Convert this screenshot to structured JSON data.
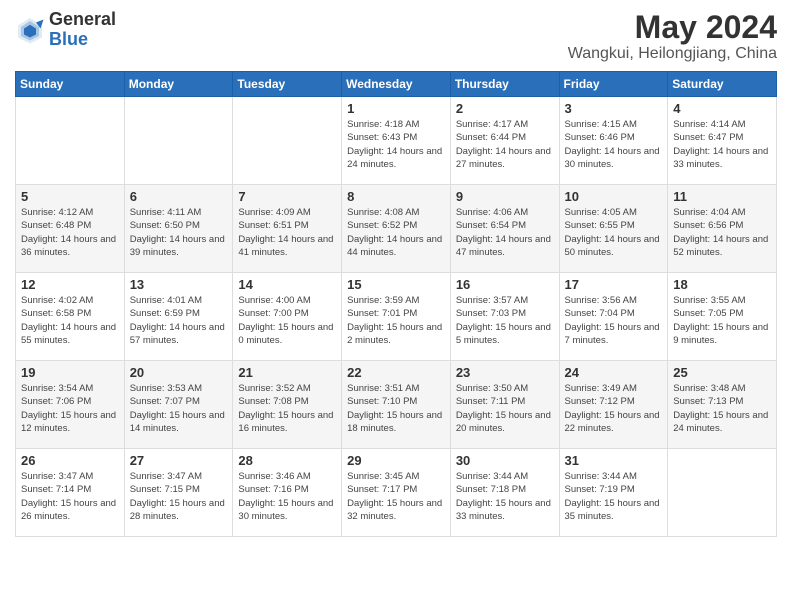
{
  "header": {
    "logo_general": "General",
    "logo_blue": "Blue",
    "month_title": "May 2024",
    "subtitle": "Wangkui, Heilongjiang, China"
  },
  "days_of_week": [
    "Sunday",
    "Monday",
    "Tuesday",
    "Wednesday",
    "Thursday",
    "Friday",
    "Saturday"
  ],
  "weeks": [
    [
      {
        "day": "",
        "info": ""
      },
      {
        "day": "",
        "info": ""
      },
      {
        "day": "",
        "info": ""
      },
      {
        "day": "1",
        "info": "Sunrise: 4:18 AM\nSunset: 6:43 PM\nDaylight: 14 hours\nand 24 minutes."
      },
      {
        "day": "2",
        "info": "Sunrise: 4:17 AM\nSunset: 6:44 PM\nDaylight: 14 hours\nand 27 minutes."
      },
      {
        "day": "3",
        "info": "Sunrise: 4:15 AM\nSunset: 6:46 PM\nDaylight: 14 hours\nand 30 minutes."
      },
      {
        "day": "4",
        "info": "Sunrise: 4:14 AM\nSunset: 6:47 PM\nDaylight: 14 hours\nand 33 minutes."
      }
    ],
    [
      {
        "day": "5",
        "info": "Sunrise: 4:12 AM\nSunset: 6:48 PM\nDaylight: 14 hours\nand 36 minutes."
      },
      {
        "day": "6",
        "info": "Sunrise: 4:11 AM\nSunset: 6:50 PM\nDaylight: 14 hours\nand 39 minutes."
      },
      {
        "day": "7",
        "info": "Sunrise: 4:09 AM\nSunset: 6:51 PM\nDaylight: 14 hours\nand 41 minutes."
      },
      {
        "day": "8",
        "info": "Sunrise: 4:08 AM\nSunset: 6:52 PM\nDaylight: 14 hours\nand 44 minutes."
      },
      {
        "day": "9",
        "info": "Sunrise: 4:06 AM\nSunset: 6:54 PM\nDaylight: 14 hours\nand 47 minutes."
      },
      {
        "day": "10",
        "info": "Sunrise: 4:05 AM\nSunset: 6:55 PM\nDaylight: 14 hours\nand 50 minutes."
      },
      {
        "day": "11",
        "info": "Sunrise: 4:04 AM\nSunset: 6:56 PM\nDaylight: 14 hours\nand 52 minutes."
      }
    ],
    [
      {
        "day": "12",
        "info": "Sunrise: 4:02 AM\nSunset: 6:58 PM\nDaylight: 14 hours\nand 55 minutes."
      },
      {
        "day": "13",
        "info": "Sunrise: 4:01 AM\nSunset: 6:59 PM\nDaylight: 14 hours\nand 57 minutes."
      },
      {
        "day": "14",
        "info": "Sunrise: 4:00 AM\nSunset: 7:00 PM\nDaylight: 15 hours\nand 0 minutes."
      },
      {
        "day": "15",
        "info": "Sunrise: 3:59 AM\nSunset: 7:01 PM\nDaylight: 15 hours\nand 2 minutes."
      },
      {
        "day": "16",
        "info": "Sunrise: 3:57 AM\nSunset: 7:03 PM\nDaylight: 15 hours\nand 5 minutes."
      },
      {
        "day": "17",
        "info": "Sunrise: 3:56 AM\nSunset: 7:04 PM\nDaylight: 15 hours\nand 7 minutes."
      },
      {
        "day": "18",
        "info": "Sunrise: 3:55 AM\nSunset: 7:05 PM\nDaylight: 15 hours\nand 9 minutes."
      }
    ],
    [
      {
        "day": "19",
        "info": "Sunrise: 3:54 AM\nSunset: 7:06 PM\nDaylight: 15 hours\nand 12 minutes."
      },
      {
        "day": "20",
        "info": "Sunrise: 3:53 AM\nSunset: 7:07 PM\nDaylight: 15 hours\nand 14 minutes."
      },
      {
        "day": "21",
        "info": "Sunrise: 3:52 AM\nSunset: 7:08 PM\nDaylight: 15 hours\nand 16 minutes."
      },
      {
        "day": "22",
        "info": "Sunrise: 3:51 AM\nSunset: 7:10 PM\nDaylight: 15 hours\nand 18 minutes."
      },
      {
        "day": "23",
        "info": "Sunrise: 3:50 AM\nSunset: 7:11 PM\nDaylight: 15 hours\nand 20 minutes."
      },
      {
        "day": "24",
        "info": "Sunrise: 3:49 AM\nSunset: 7:12 PM\nDaylight: 15 hours\nand 22 minutes."
      },
      {
        "day": "25",
        "info": "Sunrise: 3:48 AM\nSunset: 7:13 PM\nDaylight: 15 hours\nand 24 minutes."
      }
    ],
    [
      {
        "day": "26",
        "info": "Sunrise: 3:47 AM\nSunset: 7:14 PM\nDaylight: 15 hours\nand 26 minutes."
      },
      {
        "day": "27",
        "info": "Sunrise: 3:47 AM\nSunset: 7:15 PM\nDaylight: 15 hours\nand 28 minutes."
      },
      {
        "day": "28",
        "info": "Sunrise: 3:46 AM\nSunset: 7:16 PM\nDaylight: 15 hours\nand 30 minutes."
      },
      {
        "day": "29",
        "info": "Sunrise: 3:45 AM\nSunset: 7:17 PM\nDaylight: 15 hours\nand 32 minutes."
      },
      {
        "day": "30",
        "info": "Sunrise: 3:44 AM\nSunset: 7:18 PM\nDaylight: 15 hours\nand 33 minutes."
      },
      {
        "day": "31",
        "info": "Sunrise: 3:44 AM\nSunset: 7:19 PM\nDaylight: 15 hours\nand 35 minutes."
      },
      {
        "day": "",
        "info": ""
      }
    ]
  ]
}
